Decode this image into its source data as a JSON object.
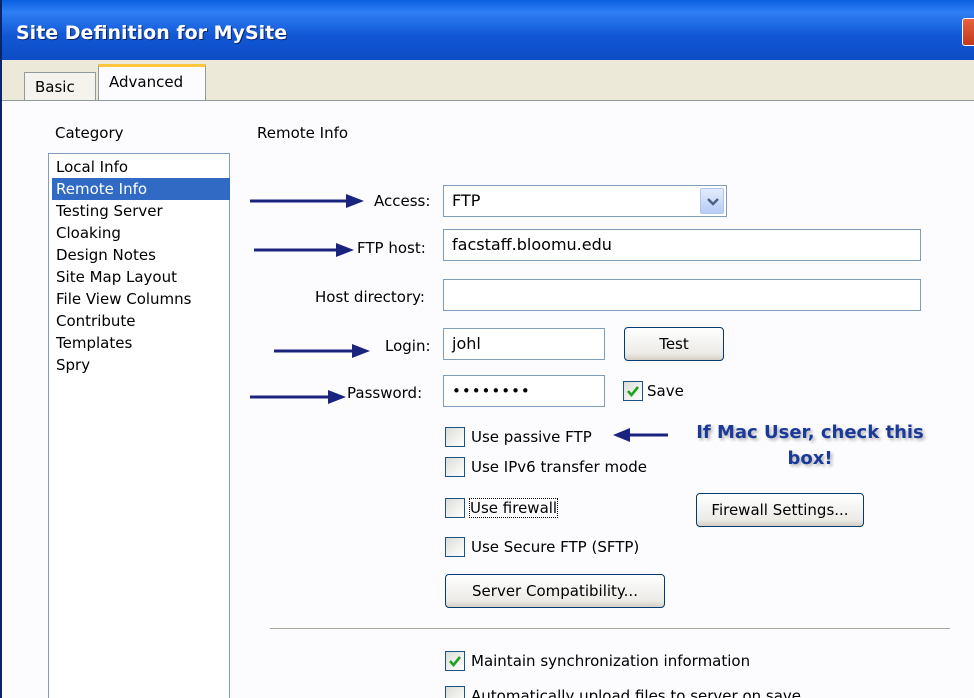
{
  "window": {
    "title": "Site Definition for MySite"
  },
  "tabs": [
    {
      "label": "Basic"
    },
    {
      "label": "Advanced"
    }
  ],
  "category": {
    "header": "Category",
    "items": [
      "Local Info",
      "Remote Info",
      "Testing Server",
      "Cloaking",
      "Design Notes",
      "Site Map Layout",
      "File View Columns",
      "Contribute",
      "Templates",
      "Spry"
    ],
    "selected": "Remote Info"
  },
  "remote": {
    "section_title": "Remote Info",
    "access_label": "Access:",
    "access_value": "FTP",
    "ftp_host_label": "FTP host:",
    "ftp_host_value": "facstaff.bloomu.edu",
    "host_dir_label": "Host directory:",
    "host_dir_value": "",
    "login_label": "Login:",
    "login_value": "johl",
    "test_button": "Test",
    "password_label": "Password:",
    "password_value": "••••••••",
    "save_label": "Save",
    "save_checked": true,
    "passive_label": "Use passive FTP",
    "ipv6_label": "Use IPv6 transfer mode",
    "firewall_label": "Use firewall",
    "firewall_settings_button": "Firewall Settings...",
    "sftp_label": "Use Secure FTP (SFTP)",
    "server_compat_button": "Server Compatibility...",
    "maintain_sync_label": "Maintain synchronization information",
    "maintain_sync_checked": true,
    "auto_upload_label": "Automatically upload files to server on save"
  },
  "annotation": {
    "line1": "If Mac User, check this",
    "line2": "box!"
  },
  "colors": {
    "titlebar": "#0a5fe0",
    "selection": "#316ac5",
    "annotation_arrow": "#1a237e",
    "annotation_text": "#1a3a9a"
  }
}
